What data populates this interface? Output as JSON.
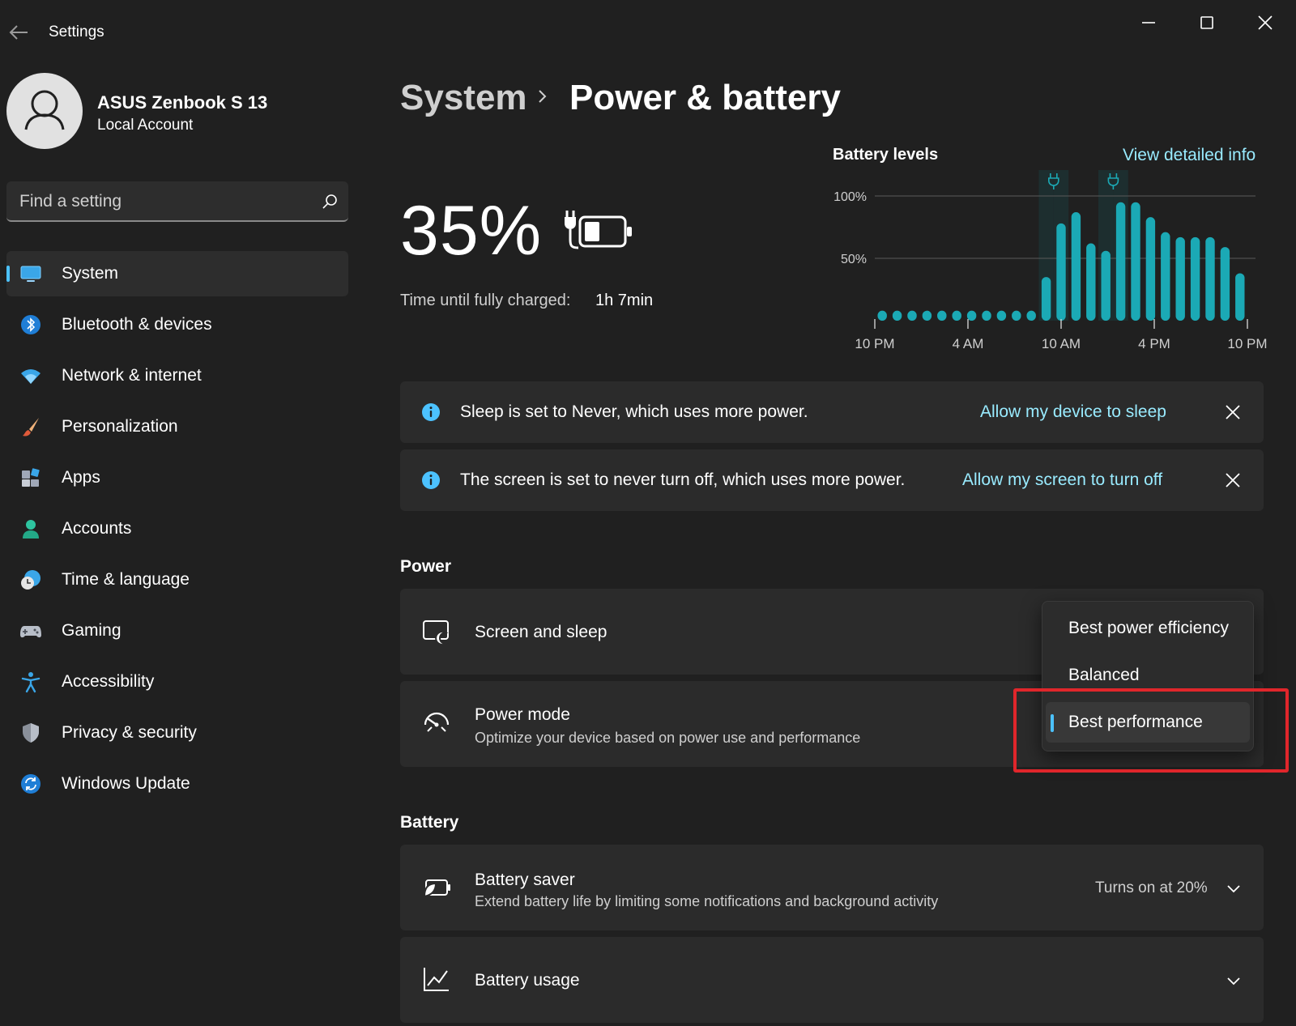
{
  "window": {
    "title": "Settings"
  },
  "account": {
    "name": "ASUS Zenbook S 13",
    "type": "Local Account"
  },
  "search": {
    "placeholder": "Find a setting"
  },
  "sidebar": {
    "items": [
      {
        "label": "System",
        "icon": "monitor-icon",
        "active": true
      },
      {
        "label": "Bluetooth & devices",
        "icon": "bluetooth-icon"
      },
      {
        "label": "Network & internet",
        "icon": "wifi-icon"
      },
      {
        "label": "Personalization",
        "icon": "brush-icon"
      },
      {
        "label": "Apps",
        "icon": "apps-icon"
      },
      {
        "label": "Accounts",
        "icon": "person-icon"
      },
      {
        "label": "Time & language",
        "icon": "clock-globe-icon"
      },
      {
        "label": "Gaming",
        "icon": "gamepad-icon"
      },
      {
        "label": "Accessibility",
        "icon": "accessibility-icon"
      },
      {
        "label": "Privacy & security",
        "icon": "shield-icon"
      },
      {
        "label": "Windows Update",
        "icon": "update-icon"
      }
    ]
  },
  "header": {
    "parent": "System",
    "current": "Power & battery"
  },
  "battery_summary": {
    "percent": "35%",
    "charge_label": "Time until fully charged:",
    "charge_value": "1h 7min"
  },
  "battery_levels": {
    "title": "Battery levels",
    "link": "View detailed info"
  },
  "chart_data": {
    "type": "bar",
    "title": "Battery levels",
    "y_ticks": [
      "100%",
      "50%"
    ],
    "x_ticks": [
      "10 PM",
      "4 AM",
      "10 AM",
      "4 PM",
      "10 PM"
    ],
    "ylim": [
      0,
      100
    ],
    "values": [
      8,
      8,
      8,
      8,
      8,
      8,
      8,
      8,
      8,
      8,
      8,
      35,
      78,
      87,
      62,
      56,
      95,
      95,
      83,
      71,
      67,
      67,
      67,
      59,
      38
    ],
    "charging_bars": [
      11,
      12,
      15,
      16
    ],
    "grid": true,
    "bar_color": "#1ba9b5"
  },
  "notices": [
    {
      "text": "Sleep is set to Never, which uses more power.",
      "link": "Allow my device to sleep"
    },
    {
      "text": "The screen is set to never turn off, which uses more power.",
      "link": "Allow my screen to turn off"
    }
  ],
  "power": {
    "section_title": "Power",
    "screen_sleep": {
      "title": "Screen and sleep"
    },
    "power_mode": {
      "title": "Power mode",
      "subtitle": "Optimize your device based on power use and performance"
    }
  },
  "dropdown": {
    "options": [
      "Best power efficiency",
      "Balanced",
      "Best performance"
    ],
    "selected": "Best performance"
  },
  "battery": {
    "section_title": "Battery",
    "saver": {
      "title": "Battery saver",
      "subtitle": "Extend battery life by limiting some notifications and background activity",
      "value": "Turns on at 20%"
    },
    "usage": {
      "title": "Battery usage"
    }
  },
  "colors": {
    "accent": "#4cc2ff",
    "link": "#99ebff",
    "highlight": "#e0262b"
  }
}
